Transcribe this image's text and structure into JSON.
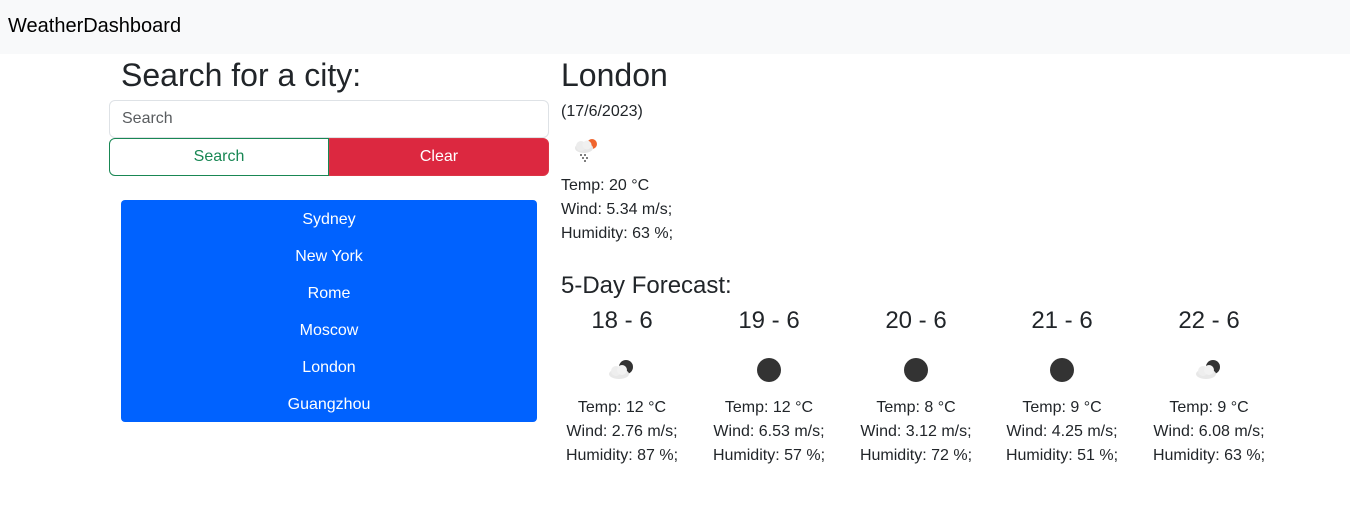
{
  "brand": "WeatherDashboard",
  "search": {
    "title": "Search for a city:",
    "placeholder": "Search",
    "search_label": "Search",
    "clear_label": "Clear"
  },
  "history": [
    "Sydney",
    "New York",
    "Rome",
    "Moscow",
    "London",
    "Guangzhou"
  ],
  "current": {
    "city": "London",
    "date": "(17/6/2023)",
    "icon": "light-snow-sun-icon",
    "temp": "Temp: 20 °C",
    "wind": "Wind: 5.34 m/s;",
    "humidity": "Humidity: 63 %;"
  },
  "forecast": {
    "title": "5-Day Forecast:",
    "days": [
      {
        "date": "18 - 6",
        "icon": "partly-cloudy-night-icon",
        "temp": "Temp: 12 °C",
        "wind": "Wind: 2.76 m/s;",
        "humidity": "Humidity: 87 %;"
      },
      {
        "date": "19 - 6",
        "icon": "clear-night-icon",
        "temp": "Temp: 12 °C",
        "wind": "Wind: 6.53 m/s;",
        "humidity": "Humidity: 57 %;"
      },
      {
        "date": "20 - 6",
        "icon": "clear-night-icon",
        "temp": "Temp: 8 °C",
        "wind": "Wind: 3.12 m/s;",
        "humidity": "Humidity: 72 %;"
      },
      {
        "date": "21 - 6",
        "icon": "clear-night-icon",
        "temp": "Temp: 9 °C",
        "wind": "Wind: 4.25 m/s;",
        "humidity": "Humidity: 51 %;"
      },
      {
        "date": "22 - 6",
        "icon": "partly-cloudy-night-icon",
        "temp": "Temp: 9 °C",
        "wind": "Wind: 6.08 m/s;",
        "humidity": "Humidity: 63 %;"
      }
    ]
  },
  "colors": {
    "navbar": "#f8f9fa",
    "search_outline": "#198754",
    "clear_red": "#dc2840",
    "history_blue": "#0062ff"
  }
}
